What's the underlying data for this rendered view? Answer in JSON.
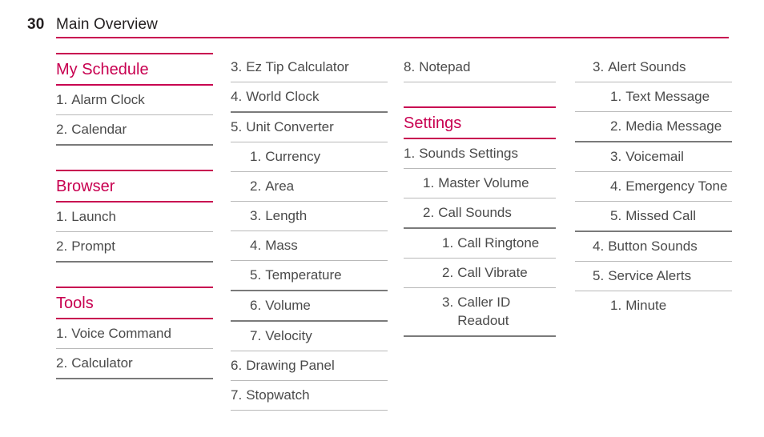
{
  "header": {
    "page_number": "30",
    "title": "Main Overview",
    "rule_color": "#c80050"
  },
  "colors": {
    "accent": "#c80050",
    "text": "#4a4a4a",
    "header_text": "#231f20",
    "rule_light": "#b9b9b9",
    "rule_strong": "#7a7a7a"
  },
  "columns": [
    {
      "blocks": [
        {
          "type": "section",
          "heading": "My Schedule",
          "rows": [
            {
              "num": "1.",
              "label": "Alarm Clock",
              "level": 1,
              "rule": "light"
            },
            {
              "num": "2.",
              "label": "Calendar",
              "level": 1,
              "rule": "strong"
            }
          ]
        },
        {
          "type": "gap"
        },
        {
          "type": "section",
          "heading": "Browser",
          "rows": [
            {
              "num": "1.",
              "label": "Launch",
              "level": 1,
              "rule": "light"
            },
            {
              "num": "2.",
              "label": "Prompt",
              "level": 1,
              "rule": "strong"
            }
          ]
        },
        {
          "type": "gap"
        },
        {
          "type": "section",
          "heading": "Tools",
          "rows": [
            {
              "num": "1.",
              "label": "Voice Command",
              "level": 1,
              "rule": "light"
            },
            {
              "num": "2.",
              "label": "Calculator",
              "level": 1,
              "rule": "strong"
            }
          ]
        }
      ]
    },
    {
      "blocks": [
        {
          "type": "list",
          "rows": [
            {
              "num": "3.",
              "label": "Ez Tip Calculator",
              "level": 1,
              "rule": "light"
            },
            {
              "num": "4.",
              "label": "World Clock",
              "level": 1,
              "rule": "strong"
            },
            {
              "num": "5.",
              "label": "Unit Converter",
              "level": 1,
              "rule": "light"
            },
            {
              "num": "1.",
              "label": "Currency",
              "level": 2,
              "rule": "light"
            },
            {
              "num": "2.",
              "label": "Area",
              "level": 2,
              "rule": "light"
            },
            {
              "num": "3.",
              "label": "Length",
              "level": 2,
              "rule": "light"
            },
            {
              "num": "4.",
              "label": "Mass",
              "level": 2,
              "rule": "light"
            },
            {
              "num": "5.",
              "label": "Temperature",
              "level": 2,
              "rule": "strong"
            },
            {
              "num": "6.",
              "label": "Volume",
              "level": 2,
              "rule": "strong"
            },
            {
              "num": "7.",
              "label": "Velocity",
              "level": 2,
              "rule": "light"
            },
            {
              "num": "6.",
              "label": "Drawing Panel",
              "level": 1,
              "rule": "light"
            },
            {
              "num": "7.",
              "label": "Stopwatch",
              "level": 1,
              "rule": "light"
            }
          ]
        }
      ]
    },
    {
      "blocks": [
        {
          "type": "list",
          "rows": [
            {
              "num": "8.",
              "label": "Notepad",
              "level": 1,
              "rule": "light"
            }
          ]
        },
        {
          "type": "gap"
        },
        {
          "type": "section",
          "heading": "Settings",
          "rows": [
            {
              "num": "1.",
              "label": "Sounds Settings",
              "level": 1,
              "rule": "light"
            },
            {
              "num": "1.",
              "label": "Master Volume",
              "level": 2,
              "rule": "light"
            },
            {
              "num": "2.",
              "label": "Call Sounds",
              "level": 2,
              "rule": "strong"
            },
            {
              "num": "1.",
              "label": "Call Ringtone",
              "level": 3,
              "rule": "light"
            },
            {
              "num": "2.",
              "label": "Call Vibrate",
              "level": 3,
              "rule": "light"
            },
            {
              "num": "3.",
              "label": "Caller ID Readout",
              "level": 3,
              "rule": "strong"
            }
          ]
        }
      ]
    },
    {
      "blocks": [
        {
          "type": "list",
          "rows": [
            {
              "num": "3.",
              "label": "Alert Sounds",
              "level": 1,
              "rule": "light"
            },
            {
              "num": "1.",
              "label": "Text Message",
              "level": 2,
              "rule": "light"
            },
            {
              "num": "2.",
              "label": "Media Message",
              "level": 2,
              "rule": "strong"
            },
            {
              "num": "3.",
              "label": "Voicemail",
              "level": 2,
              "rule": "light"
            },
            {
              "num": "4.",
              "label": "Emergency Tone",
              "level": 2,
              "rule": "light"
            },
            {
              "num": "5.",
              "label": "Missed Call",
              "level": 2,
              "rule": "strong"
            },
            {
              "num": "4.",
              "label": "Button Sounds",
              "level": 1,
              "rule": "light"
            },
            {
              "num": "5.",
              "label": "Service Alerts",
              "level": 1,
              "rule": "light"
            },
            {
              "num": "1.",
              "label": "Minute",
              "level": 2,
              "rule": "none"
            }
          ]
        }
      ]
    }
  ]
}
